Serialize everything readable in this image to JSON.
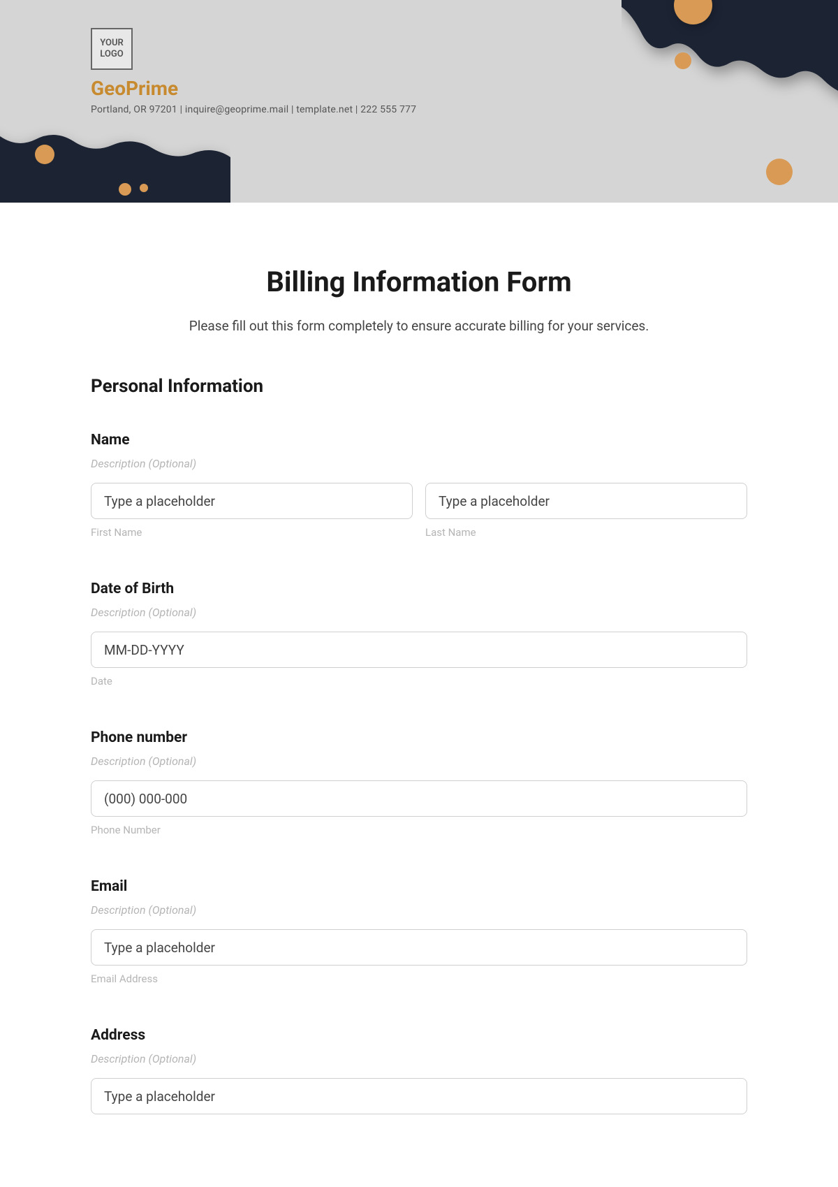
{
  "header": {
    "logo_text": "YOUR\nLOGO",
    "brand_name": "GeoPrime",
    "contact_line": "Portland, OR 97201 | inquire@geoprime.mail | template.net | 222 555 777"
  },
  "form": {
    "title": "Billing Information Form",
    "instruction": "Please fill out this form completely to ensure accurate billing for your services.",
    "section_heading": "Personal Information",
    "fields": {
      "name": {
        "label": "Name",
        "description": "Description (Optional)",
        "first_placeholder": "Type a placeholder",
        "last_placeholder": "Type a placeholder",
        "first_sublabel": "First Name",
        "last_sublabel": "Last Name"
      },
      "dob": {
        "label": "Date of Birth",
        "description": "Description (Optional)",
        "placeholder": "MM-DD-YYYY",
        "sublabel": "Date"
      },
      "phone": {
        "label": "Phone number",
        "description": "Description (Optional)",
        "placeholder": "(000) 000-000",
        "sublabel": "Phone Number"
      },
      "email": {
        "label": "Email",
        "description": "Description (Optional)",
        "placeholder": "Type a placeholder",
        "sublabel": "Email Address"
      },
      "address": {
        "label": "Address",
        "description": "Description (Optional)",
        "placeholder": "Type a placeholder"
      }
    }
  }
}
